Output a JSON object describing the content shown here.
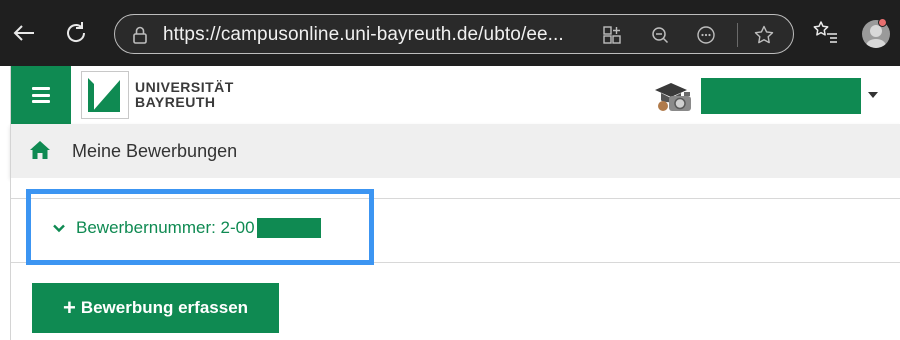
{
  "browser": {
    "url": "https://campusonline.uni-bayreuth.de/ubto/ee..."
  },
  "header": {
    "logo_line1": "UNIVERSITÄT",
    "logo_line2": "BAYREUTH"
  },
  "breadcrumb": {
    "title": "Meine Bewerbungen"
  },
  "accordion": {
    "label": "Bewerbernummer: 2-00"
  },
  "actions": {
    "add_label": "Bewerbung erfassen"
  },
  "colors": {
    "brand_green": "#0f8a52",
    "highlight_blue": "#3c95f2",
    "browser_bg": "#1f1f1f"
  }
}
